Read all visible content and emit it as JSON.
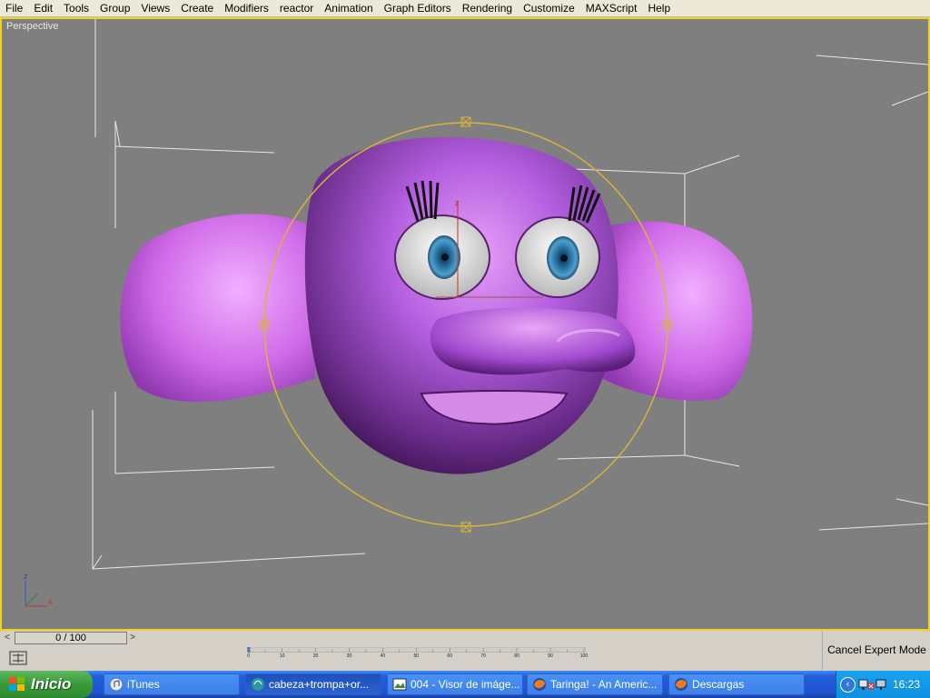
{
  "menu": [
    "File",
    "Edit",
    "Tools",
    "Group",
    "Views",
    "Create",
    "Modifiers",
    "reactor",
    "Animation",
    "Graph Editors",
    "Rendering",
    "Customize",
    "MAXScript",
    "Help"
  ],
  "viewport": {
    "label": "Perspective",
    "gizmo_axis_label": "z",
    "gizmo_x_label": "x",
    "axis_tripod": {
      "z": "z",
      "x": "x"
    }
  },
  "timeline": {
    "prev_symbol": "<",
    "next_symbol": ">",
    "slider_text": "0 / 100",
    "ticks": [
      "0",
      "10",
      "20",
      "30",
      "40",
      "50",
      "60",
      "70",
      "80",
      "90",
      "100"
    ]
  },
  "expert_mode": {
    "label": "Cancel Expert Mode"
  },
  "taskbar": {
    "start_label": "Inicio",
    "items": [
      {
        "label": "iTunes",
        "icon": "itunes-icon"
      },
      {
        "label": "cabeza+trompa+or...",
        "icon": "max-icon"
      },
      {
        "label": "004 - Visor de imáge...",
        "icon": "image-viewer-icon"
      },
      {
        "label": "Taringa! - An Americ...",
        "icon": "firefox-icon"
      },
      {
        "label": "Descargas",
        "icon": "firefox-icon"
      }
    ],
    "clock": "16:23"
  },
  "colors": {
    "viewport_bg": "#7f7f7f",
    "active_border": "#f0d020",
    "model": "#b25ae0",
    "ear": "#d56ef0",
    "iris": "#2f78a8"
  }
}
